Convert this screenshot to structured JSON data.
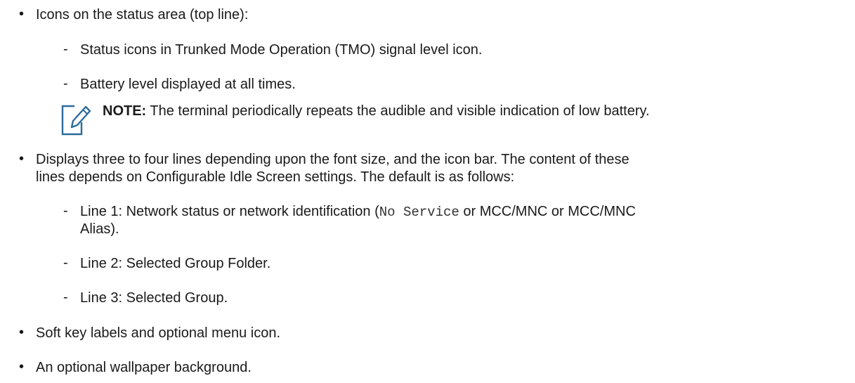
{
  "bullet_glyph": "•",
  "dash_glyph": "-",
  "items": [
    {
      "text": "Icons on the status area (top line):"
    },
    {
      "text": "Status icons in Trunked Mode Operation (TMO) signal level icon."
    },
    {
      "text": "Battery level displayed at all times."
    },
    {
      "note_label": "NOTE:",
      "note_text": " The terminal periodically repeats the audible and visible indication of low battery."
    },
    {
      "text_line1": "Displays three to four lines depending upon the font size, and the icon bar. The content of these",
      "text_line2": "lines depends on Configurable Idle Screen settings. The default is as follows:"
    },
    {
      "prefix": "Line 1: Network status or network identification (",
      "code": "No Service",
      "suffix": " or MCC/MNC or MCC/MNC",
      "line2": "Alias)."
    },
    {
      "text": "Line 2: Selected Group Folder."
    },
    {
      "text": "Line 3: Selected Group."
    },
    {
      "text": "Soft key labels and optional menu icon."
    },
    {
      "text": "An optional wallpaper background."
    }
  ]
}
